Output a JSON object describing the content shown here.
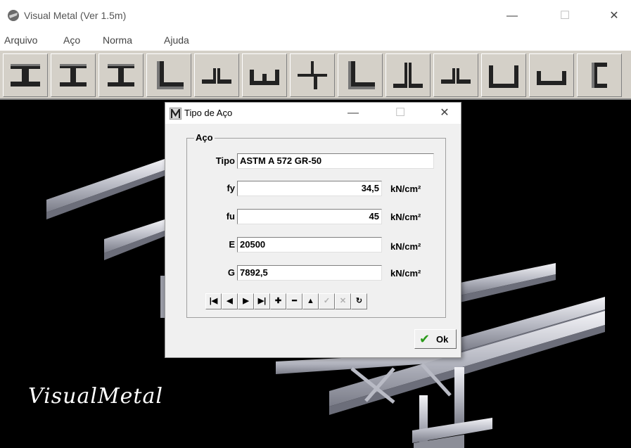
{
  "app": {
    "title": "Visual Metal (Ver 1.5m)"
  },
  "window_controls": {
    "minimize": "—",
    "maximize": "☐",
    "close": "✕"
  },
  "menu": [
    "Arquivo",
    "Aço",
    "Norma",
    "Ajuda"
  ],
  "toolbar": {
    "buttons": [
      "i-beam-icon",
      "i-beam-icon",
      "i-beam-icon",
      "angle-icon",
      "double-angle-icon",
      "channel-icon",
      "z-section-icon",
      "angle-icon",
      "double-angle-icon",
      "double-angle-icon",
      "channel-icon",
      "channel-icon",
      "c-channel-icon"
    ]
  },
  "viewport": {
    "logo_text": "VisualMetal"
  },
  "dialog": {
    "title": "Tipo de Aço",
    "group_label": "Aço",
    "fields": {
      "tipo": {
        "label": "Tipo",
        "value": "ASTM A 572 GR-50"
      },
      "fy": {
        "label": "fy",
        "value": "34,5",
        "unit": "kN/cm²"
      },
      "fu": {
        "label": "fu",
        "value": "45",
        "unit": "kN/cm²"
      },
      "E": {
        "label": "E",
        "value": "20500",
        "unit": "kN/cm²"
      },
      "G": {
        "label": "G",
        "value": "7892,5",
        "unit": "kN/cm²"
      }
    },
    "nav_buttons": [
      {
        "glyph": "|◀",
        "name": "nav-first-button",
        "enabled": true
      },
      {
        "glyph": "◀",
        "name": "nav-prior-button",
        "enabled": true
      },
      {
        "glyph": "▶",
        "name": "nav-next-button",
        "enabled": true
      },
      {
        "glyph": "▶|",
        "name": "nav-last-button",
        "enabled": true
      },
      {
        "glyph": "✚",
        "name": "nav-insert-button",
        "enabled": true
      },
      {
        "glyph": "━",
        "name": "nav-delete-button",
        "enabled": true
      },
      {
        "glyph": "▲",
        "name": "nav-edit-button",
        "enabled": true
      },
      {
        "glyph": "✓",
        "name": "nav-post-button",
        "enabled": false
      },
      {
        "glyph": "✕",
        "name": "nav-cancel-button",
        "enabled": false
      },
      {
        "glyph": "↻",
        "name": "nav-refresh-button",
        "enabled": true
      }
    ],
    "ok_label": "Ok"
  }
}
